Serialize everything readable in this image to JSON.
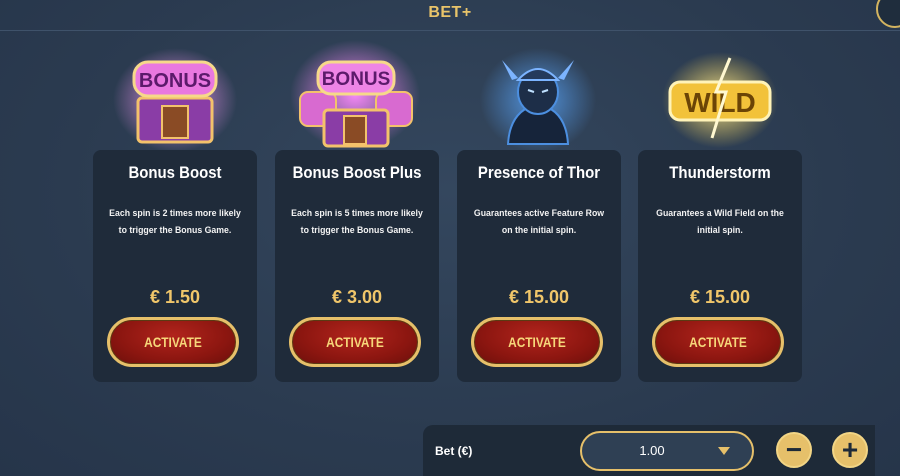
{
  "header": {
    "title": "BET+"
  },
  "cards": [
    {
      "name": "Bonus Boost",
      "description": "Each spin is 2 times more likely to trigger the Bonus Game.",
      "price": "€ 1.50",
      "button": "ACTIVATE",
      "art_label": "BONUS"
    },
    {
      "name": "Bonus Boost Plus",
      "description": "Each spin is 5 times more likely to trigger the Bonus Game.",
      "price": "€ 3.00",
      "button": "ACTIVATE",
      "art_label": "BONUS"
    },
    {
      "name": "Presence of Thor",
      "description": "Guarantees active Feature Row on the initial spin.",
      "price": "€ 15.00",
      "button": "ACTIVATE"
    },
    {
      "name": "Thunderstorm",
      "description": "Guarantees a Wild Field on the initial spin.",
      "price": "€ 15.00",
      "button": "ACTIVATE",
      "art_label": "WILD"
    }
  ],
  "bet": {
    "label": "Bet (€)",
    "value": "1.00",
    "minus": "−",
    "plus": "+"
  },
  "colors": {
    "accent_gold": "#e6c06a",
    "button_red": "#8c1610",
    "card_bg": "#1f2b3a",
    "background": "#2d3e53"
  },
  "icons": {
    "close": "close-icon",
    "dropdown": "chevron-down-icon"
  }
}
